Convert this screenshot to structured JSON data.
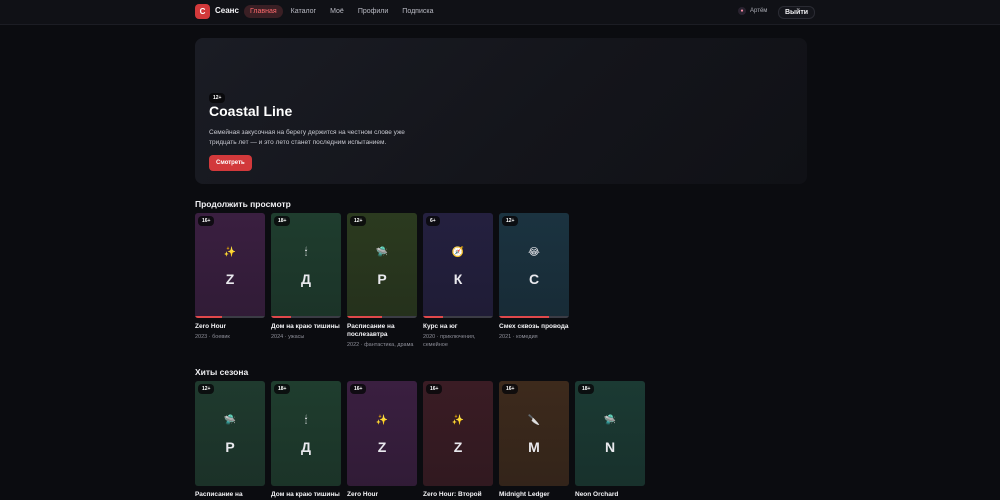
{
  "header": {
    "logo_letter": "С",
    "brand": "Сеанс",
    "nav": [
      {
        "label": "Главная",
        "active": true
      },
      {
        "label": "Каталог",
        "active": false
      },
      {
        "label": "Моё",
        "active": false
      },
      {
        "label": "Профили",
        "active": false
      },
      {
        "label": "Подписка",
        "active": false
      }
    ],
    "profile_name": "Артём",
    "logout_label": "Выйти"
  },
  "hero": {
    "rating": "12+",
    "title": "Coastal Line",
    "description": "Семейная закусочная на берегу держится на честном слове уже тридцать лет — и это лето станет последним испытанием.",
    "watch_label": "Смотреть"
  },
  "continue": {
    "title": "Продолжить просмотр",
    "items": [
      {
        "rating": "16+",
        "letter": "Z",
        "icon": "firework-icon",
        "glyph": "✨",
        "bg": "#3a1f40",
        "progress": 0.38,
        "title": "Zero Hour",
        "meta": "2023 · боевик"
      },
      {
        "rating": "18+",
        "letter": "Д",
        "icon": "candle-icon",
        "glyph": "🕯",
        "bg": "#1f3d2e",
        "progress": 0.28,
        "title": "Дом на краю тишины",
        "meta": "2024 · ужасы"
      },
      {
        "rating": "12+",
        "letter": "Р",
        "icon": "ufo-icon",
        "glyph": "🛸",
        "bg": "#2b3a1f",
        "progress": 0.5,
        "title": "Расписание на послезавтра",
        "meta": "2022 · фантастика, драма"
      },
      {
        "rating": "6+",
        "letter": "К",
        "icon": "compass-icon",
        "glyph": "🧭",
        "bg": "#24203f",
        "progress": 0.28,
        "title": "Курс на юг",
        "meta": "2020 · приключения, семейное"
      },
      {
        "rating": "12+",
        "letter": "С",
        "icon": "laughing-face-icon",
        "glyph": "😂",
        "bg": "#1b3340",
        "progress": 0.72,
        "title": "Смех сквозь провода",
        "meta": "2021 · комедия"
      }
    ]
  },
  "hits": {
    "title": "Хиты сезона",
    "items": [
      {
        "rating": "12+",
        "letter": "Р",
        "icon": "ufo-icon",
        "glyph": "🛸",
        "bg": "#1f3a2e",
        "title": "Расписание на",
        "meta": ""
      },
      {
        "rating": "18+",
        "letter": "Д",
        "icon": "candle-icon",
        "glyph": "🕯",
        "bg": "#1f3d2e",
        "title": "Дом на краю тишины",
        "meta": ""
      },
      {
        "rating": "16+",
        "letter": "Z",
        "icon": "firework-icon",
        "glyph": "✨",
        "bg": "#3a1f40",
        "title": "Zero Hour",
        "meta": ""
      },
      {
        "rating": "16+",
        "letter": "Z",
        "icon": "firework-icon",
        "glyph": "✨",
        "bg": "#3a1c24",
        "title": "Zero Hour: Второй",
        "meta": ""
      },
      {
        "rating": "16+",
        "letter": "M",
        "icon": "knife-icon",
        "glyph": "🔪",
        "bg": "#3d2a1c",
        "title": "Midnight Ledger",
        "meta": ""
      },
      {
        "rating": "18+",
        "letter": "N",
        "icon": "ufo-icon",
        "glyph": "🛸",
        "bg": "#1b3a33",
        "title": "Neon Orchard",
        "meta": ""
      }
    ]
  },
  "colors": {
    "accent": "#d2393b",
    "background": "#0b0c10"
  }
}
